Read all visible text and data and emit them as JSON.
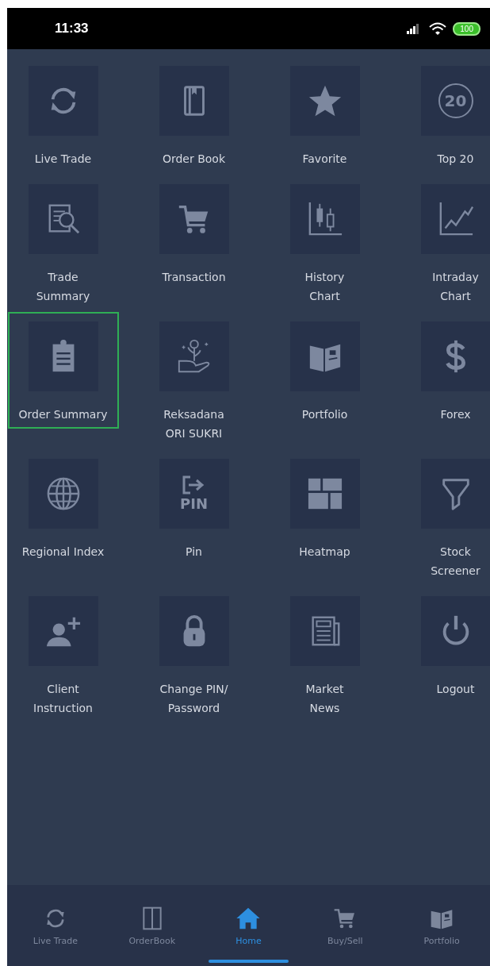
{
  "status_bar": {
    "time": "11:33",
    "battery": "100"
  },
  "menu": [
    {
      "label": "Live Trade",
      "selected": false
    },
    {
      "label": "Order Book",
      "selected": false
    },
    {
      "label": "Favorite",
      "selected": false
    },
    {
      "label": "Top 20",
      "selected": false,
      "icon_text": "20"
    },
    {
      "label": "Trade\nSummary",
      "selected": false
    },
    {
      "label": "Transaction",
      "selected": false
    },
    {
      "label": "History\nChart",
      "selected": false
    },
    {
      "label": "Intraday\nChart",
      "selected": false
    },
    {
      "label": "Order Summary",
      "selected": true
    },
    {
      "label": "Reksadana\nORI SUKRI",
      "selected": false
    },
    {
      "label": "Portfolio",
      "selected": false
    },
    {
      "label": "Forex",
      "selected": false
    },
    {
      "label": "Regional Index",
      "selected": false
    },
    {
      "label": "Pin",
      "selected": false,
      "icon_text": "PIN"
    },
    {
      "label": "Heatmap",
      "selected": false
    },
    {
      "label": "Stock\nScreener",
      "selected": false
    },
    {
      "label": "Client\nInstruction",
      "selected": false
    },
    {
      "label": "Change PIN/\nPassword",
      "selected": false
    },
    {
      "label": "Market\nNews",
      "selected": false
    },
    {
      "label": "Logout",
      "selected": false
    }
  ],
  "bottom_nav": [
    {
      "label": "Live Trade",
      "selected": false
    },
    {
      "label": "OrderBook",
      "selected": false
    },
    {
      "label": "Home",
      "selected": true
    },
    {
      "label": "Buy/Sell",
      "selected": false
    },
    {
      "label": "Portfolio",
      "selected": false
    }
  ]
}
